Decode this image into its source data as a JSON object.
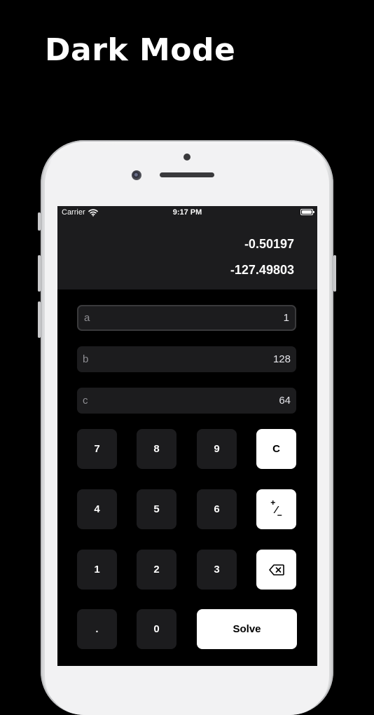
{
  "headline": "Dark Mode",
  "status_bar": {
    "carrier": "Carrier",
    "time": "9:17 PM"
  },
  "results": {
    "root1": "-0.50197",
    "root2": "-127.49803"
  },
  "fields": [
    {
      "label": "a",
      "value": "1"
    },
    {
      "label": "b",
      "value": "128"
    },
    {
      "label": "c",
      "value": "64"
    }
  ],
  "keys": {
    "k7": "7",
    "k8": "8",
    "k9": "9",
    "clear": "C",
    "k4": "4",
    "k5": "5",
    "k6": "6",
    "k1": "1",
    "k2": "2",
    "k3": "3",
    "dot": ".",
    "k0": "0",
    "solve": "Solve",
    "plus_minus_icon": "plus-minus",
    "backspace_icon": "delete-backward"
  }
}
